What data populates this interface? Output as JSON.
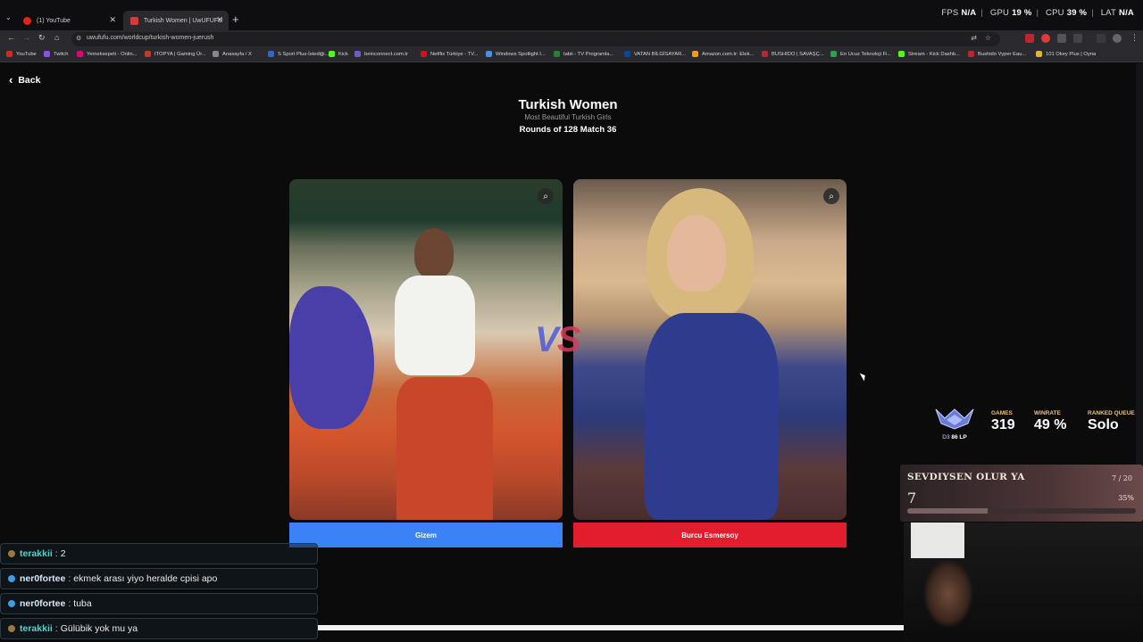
{
  "browser": {
    "tabs": [
      {
        "label": "(1) YouTube",
        "active": false
      },
      {
        "label": "Turkish Women | UwUFUFU",
        "active": true
      }
    ],
    "url": "uwufufu.com/worldcup/turkish-women-juerush",
    "bookmarks": [
      "YouTube",
      "Twitch",
      "Yemeksepeti - Onlin...",
      "ITOPYA | Gaming Ür...",
      "Anasayfa / X",
      "S Sport Plus-İstediği...",
      "Kick",
      "beinconnect.com.tr",
      "Netflix Türkiye - TV...",
      "Windows Spotlight I...",
      "tabii - TV Programla...",
      "VATAN BİLGİSAYAR...",
      "Amazon.com.tr: Elek...",
      "BUSHIDO | SAVAŞÇ...",
      "En Ucuz Teknoloji Fi...",
      "Stream - Kick Dashb...",
      "Bushido Vyper Eau...",
      "101 Okey Plus | Oyna"
    ]
  },
  "perf": {
    "fps_label": "FPS",
    "fps": "N/A",
    "gpu_label": "GPU",
    "gpu": "19 %",
    "cpu_label": "CPU",
    "cpu": "39 %",
    "lat_label": "LAT",
    "lat": "N/A"
  },
  "page": {
    "back_label": "Back",
    "title": "Turkish Women",
    "subtitle": "Most Beautiful Turkish Girls",
    "round": "Rounds of 128 Match 36",
    "vs_v": "V",
    "vs_s": "S",
    "left_choice": "Gizem",
    "right_choice": "Burcu Esmersoy",
    "accent_left": "#3b82f6",
    "accent_right": "#e11d2e"
  },
  "rank": {
    "tier": "D3",
    "lp": "86 LP",
    "games_label": "GAMES",
    "games": "319",
    "winrate_label": "WINRATE",
    "winrate": "49 %",
    "queue_label": "RANKED QUEUE",
    "queue": "Solo"
  },
  "goal": {
    "title": "SEVDIYSEN OLUR YA",
    "count": "7 / 20",
    "current": "7",
    "percent": "35%",
    "progress": 0.35
  },
  "chat": [
    {
      "user": "terakkii",
      "text": "2",
      "color": "#5ad1c8"
    },
    {
      "user": "ner0fortee",
      "text": "ekmek arası yiyo heralde cpisi apo",
      "color": "#d8e6f5"
    },
    {
      "user": "ner0fortee",
      "text": "tuba",
      "color": "#d8e6f5"
    },
    {
      "user": "terakkii",
      "text": "Gülübik yok mu ya",
      "color": "#5ad1c8"
    }
  ]
}
